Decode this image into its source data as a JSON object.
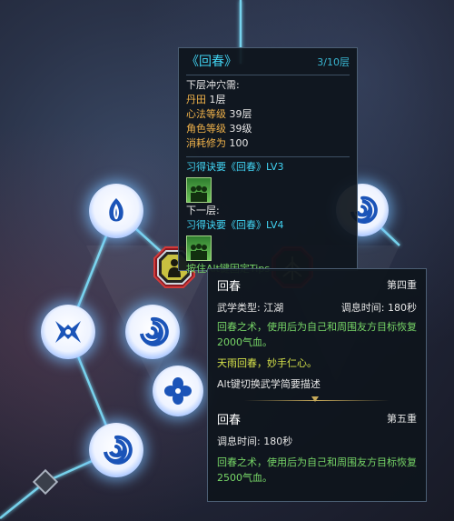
{
  "tooltip1": {
    "title": "《回春》",
    "level": "3/10层",
    "req_header": "下层冲穴需:",
    "requirements": [
      {
        "label": "丹田",
        "value": "1层"
      },
      {
        "label": "心法等级",
        "value": "39层"
      },
      {
        "label": "角色等级",
        "value": "39级"
      },
      {
        "label": "消耗修为",
        "value": "100"
      }
    ],
    "learn_current": "习得诀要《回春》LV3",
    "next_header": "下一层:",
    "learn_next": "习得诀要《回春》LV4",
    "hint": "按住Alt键固定Tips"
  },
  "tooltip2": {
    "section1": {
      "name": "回春",
      "tier": "第四重",
      "type_label": "武学类型:",
      "type_value": "江湖",
      "breath_label": "调息时间:",
      "breath_value": "180秒",
      "desc": "回春之术，使用后为自己和周围友方目标恢复2000气血。",
      "quote": "天雨回春，妙手仁心。",
      "alt_hint": "Alt键切换武学简要描述"
    },
    "section2": {
      "name": "回春",
      "tier": "第五重",
      "breath_label": "调息时间:",
      "breath_value": "180秒",
      "desc": "回春之术，使用后为自己和周围友方目标恢复2500气血。"
    }
  },
  "colors": {
    "accent_gold": "#f0b24a",
    "accent_cyan": "#41d3f2",
    "accent_green": "#77d667",
    "node_glow": "#7fc4ff"
  },
  "nodes": [
    {
      "name": "skill-node-top-left",
      "icon": "flame-icon"
    },
    {
      "name": "skill-node-mid-left",
      "icon": "mask-icon"
    },
    {
      "name": "skill-node-spiral",
      "icon": "spiral-icon"
    },
    {
      "name": "skill-node-petal",
      "icon": "petal-icon"
    },
    {
      "name": "skill-node-bottom-left",
      "icon": "spiral-icon"
    },
    {
      "name": "skill-node-right",
      "icon": "spiral-icon"
    },
    {
      "name": "skill-node-selected",
      "icon": "figure-icon"
    },
    {
      "name": "skill-node-locked",
      "icon": "tree-icon"
    }
  ]
}
